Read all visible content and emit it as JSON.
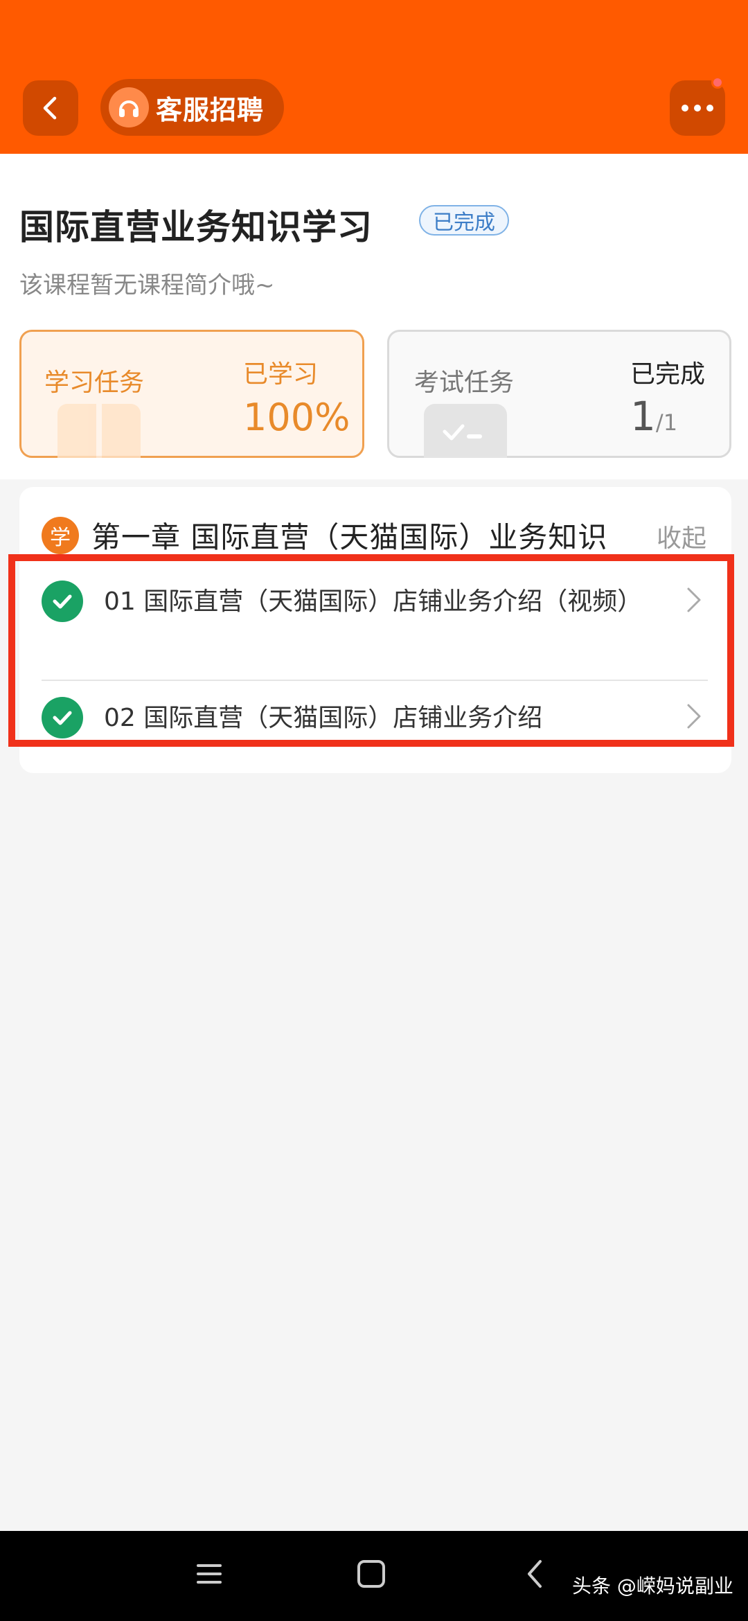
{
  "header": {
    "brand_name": "客服招聘",
    "accent_color": "#ff5a00",
    "back_icon": "chevron-left-icon",
    "more_icon": "more-dots-icon"
  },
  "course": {
    "title": "国际直营业务知识学习",
    "status": "已完成",
    "description": "该课程暂无课程简介哦~"
  },
  "tasks": {
    "study": {
      "label": "学习任务",
      "right_label": "已学习",
      "progress": "100%"
    },
    "exam": {
      "label": "考试任务",
      "right_label": "已完成",
      "completed": "1",
      "total": "/1"
    }
  },
  "chapter": {
    "badge": "学",
    "title": "第一章  国际直营（天猫国际）业务知识",
    "collapse_label": "收起",
    "lessons": [
      {
        "text": "01 国际直营（天猫国际）店铺业务介绍（视频）",
        "status": "completed"
      },
      {
        "text": "02 国际直营（天猫国际）店铺业务介绍",
        "status": "completed"
      }
    ]
  },
  "watermark": "头条 @嵘妈说副业"
}
